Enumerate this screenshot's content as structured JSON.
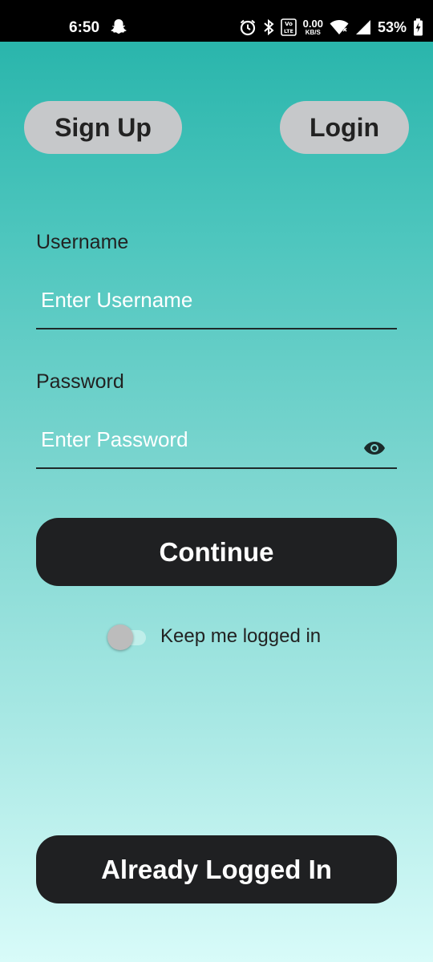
{
  "status_bar": {
    "time": "6:50",
    "netspeed_value": "0.00",
    "netspeed_unit": "KB/S",
    "battery": "53%",
    "icons": [
      "snapchat-icon",
      "alarm-icon",
      "bluetooth-icon",
      "volte-icon",
      "wifi-icon",
      "signal-icon",
      "battery-charging-icon"
    ]
  },
  "header": {
    "signup_label": "Sign Up",
    "login_label": "Login"
  },
  "form": {
    "username_label": "Username",
    "username_placeholder": "Enter Username",
    "password_label": "Password",
    "password_placeholder": "Enter Password",
    "continue_label": "Continue",
    "keep_logged_in_label": "Keep me logged in",
    "keep_logged_in_checked": false
  },
  "footer": {
    "already_logged_in_label": "Already Logged In"
  },
  "colors": {
    "gradient_top": "#22b2a8",
    "gradient_bottom": "#d8fbf9",
    "button_dark": "#1f2022",
    "button_light": "#c6c8ca"
  }
}
